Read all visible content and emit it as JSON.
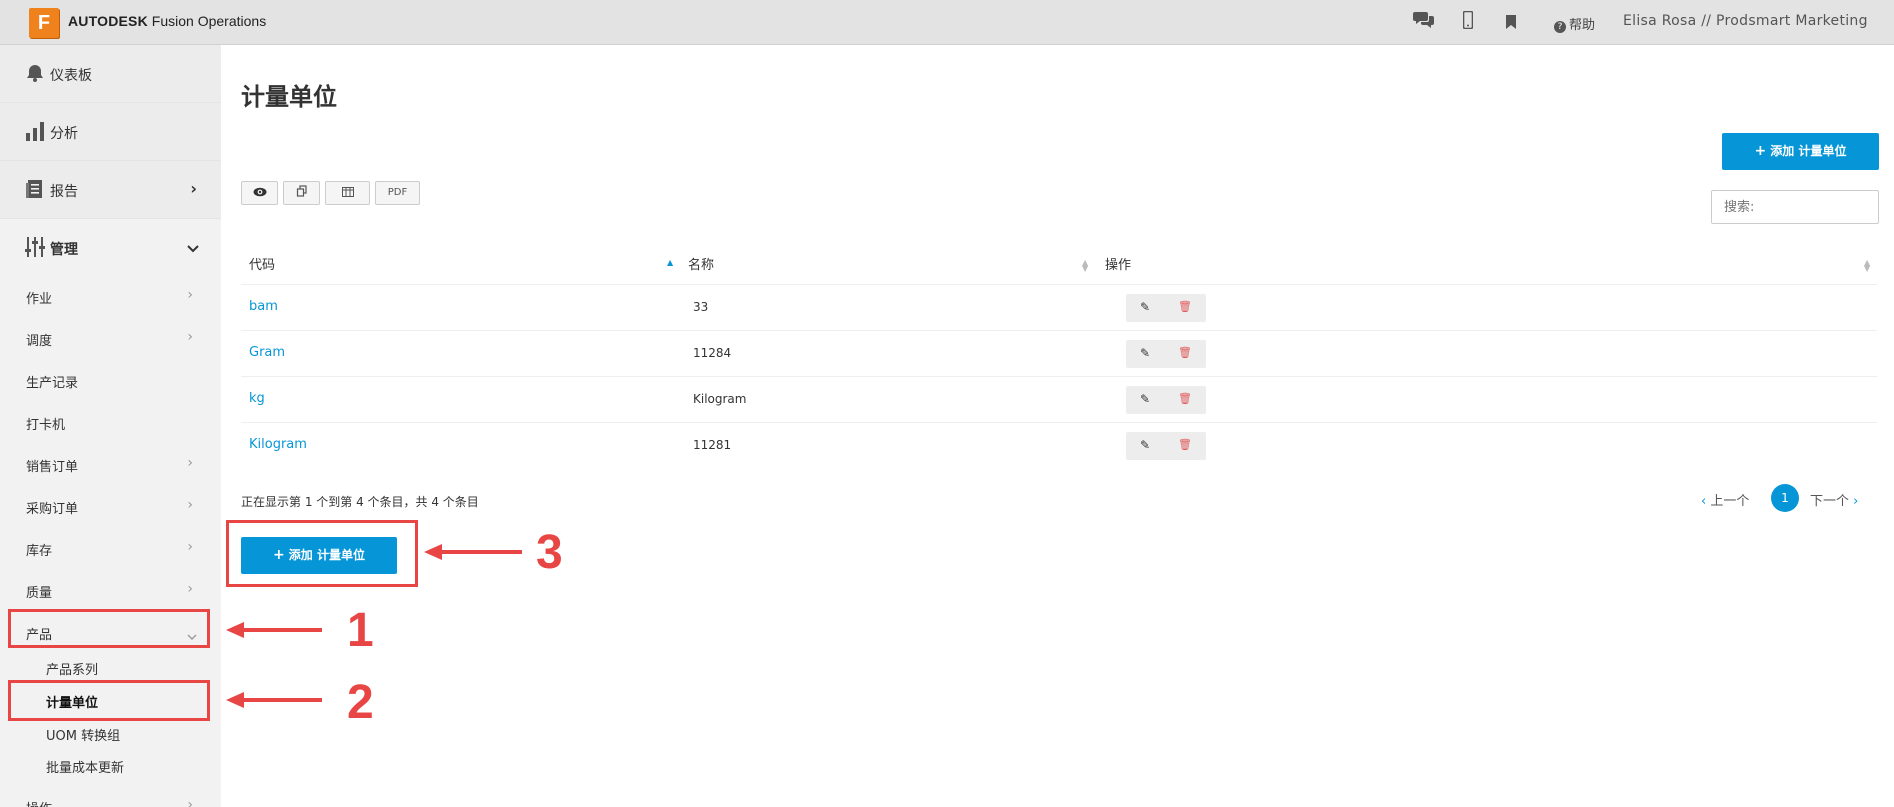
{
  "header": {
    "logo_letter": "F",
    "brand_bold": "AUTODESK",
    "brand_rest": "Fusion Operations",
    "icons": [
      "chat-icon",
      "mobile-icon",
      "bookmark-icon"
    ],
    "help_label": "帮助",
    "user": "Elisa Rosa // Prodsmart Marketing"
  },
  "sidebar": {
    "main": [
      {
        "label": "仪表板",
        "icon": "bell-icon"
      },
      {
        "label": "分析",
        "icon": "bar-chart-icon"
      },
      {
        "label": "报告",
        "icon": "report-icon"
      },
      {
        "label": "管理",
        "icon": "sliders-icon"
      }
    ],
    "items": [
      {
        "label": "作业",
        "chevron": true
      },
      {
        "label": "调度",
        "chevron": true
      },
      {
        "label": "生产记录",
        "chevron": false
      },
      {
        "label": "打卡机",
        "chevron": false
      },
      {
        "label": "销售订单",
        "chevron": true
      },
      {
        "label": "采购订单",
        "chevron": true
      },
      {
        "label": "库存",
        "chevron": true
      },
      {
        "label": "质量",
        "chevron": true
      },
      {
        "label": "产品",
        "chevron": true
      }
    ],
    "sub_items": [
      {
        "label": "产品系列"
      },
      {
        "label": "计量单位"
      },
      {
        "label": "UOM 转换组"
      },
      {
        "label": "批量成本更新"
      }
    ],
    "last_item": "操作"
  },
  "main": {
    "title": "计量单位",
    "add_button": "添加 计量单位",
    "tools": [
      "eye-icon",
      "copy-icon",
      "columns-icon",
      "PDF"
    ],
    "search_placeholder": "搜索:",
    "columns": [
      "代码",
      "名称",
      "操作"
    ],
    "rows": [
      {
        "code": "bam",
        "name": "33"
      },
      {
        "code": "Gram",
        "name": "11284"
      },
      {
        "code": "kg",
        "name": "Kilogram"
      },
      {
        "code": "Kilogram",
        "name": "11281"
      }
    ],
    "info": "正在显示第 1 个到第 4 个条目，共 4 个条目",
    "pager": {
      "prev": "上一个",
      "current": "1",
      "next": "下一个"
    }
  },
  "annotations": {
    "labels": [
      "1",
      "2",
      "3"
    ],
    "color": "#e84545"
  },
  "colors": {
    "accent": "#0696d7",
    "danger": "#e05a5a",
    "topbar": "#e3e3e3",
    "sidebar": "#f2f2f2"
  }
}
